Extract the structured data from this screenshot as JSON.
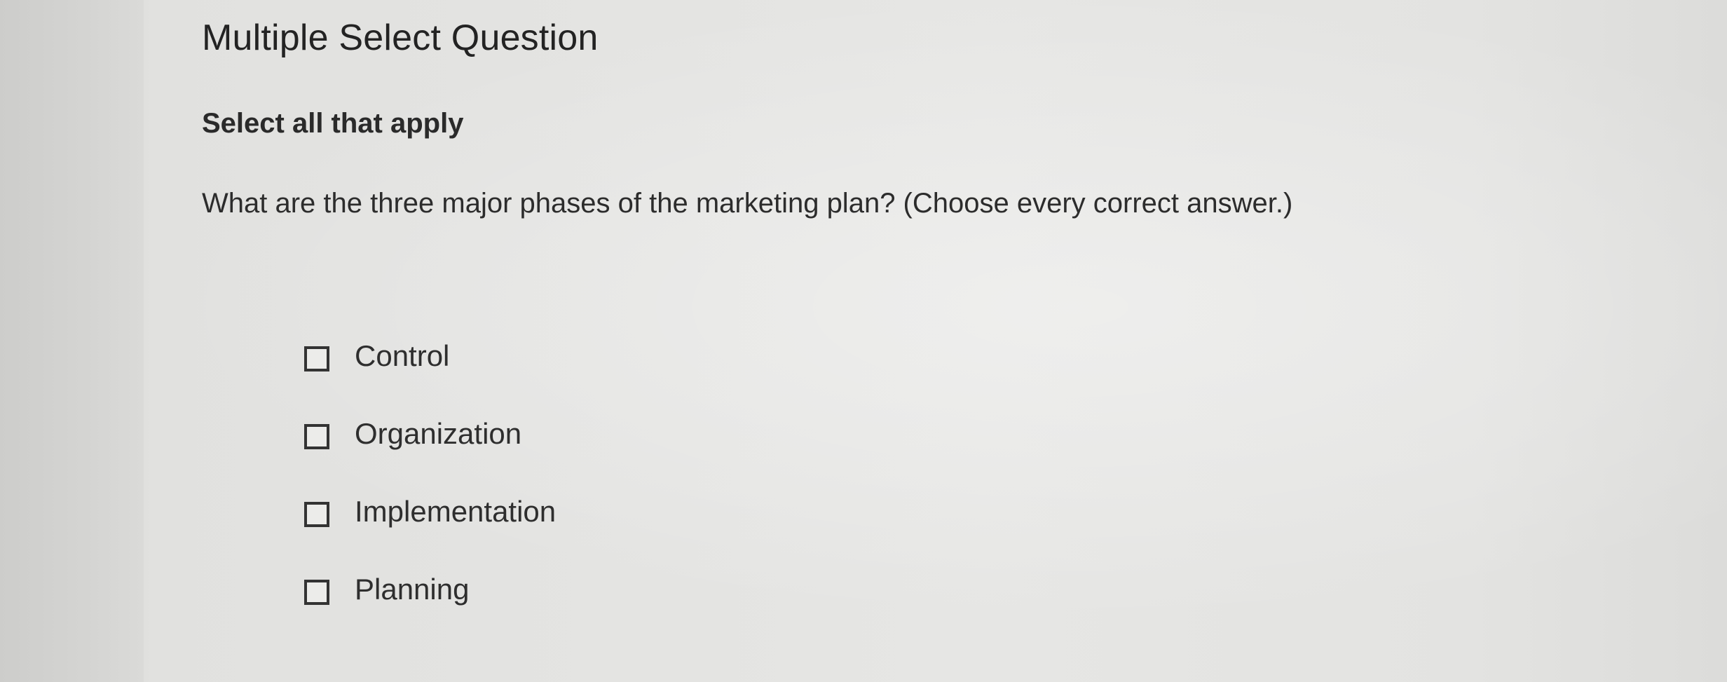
{
  "question": {
    "title": "Multiple Select Question",
    "instruction": "Select all that apply",
    "prompt": "What are the three major phases of the marketing plan? (Choose every correct answer.)",
    "options": [
      {
        "label": "Control",
        "checked": false
      },
      {
        "label": "Organization",
        "checked": false
      },
      {
        "label": "Implementation",
        "checked": false
      },
      {
        "label": "Planning",
        "checked": false
      }
    ]
  },
  "colors": {
    "background": "#e3e3e1",
    "text": "#262626",
    "checkbox_border": "#333333"
  }
}
